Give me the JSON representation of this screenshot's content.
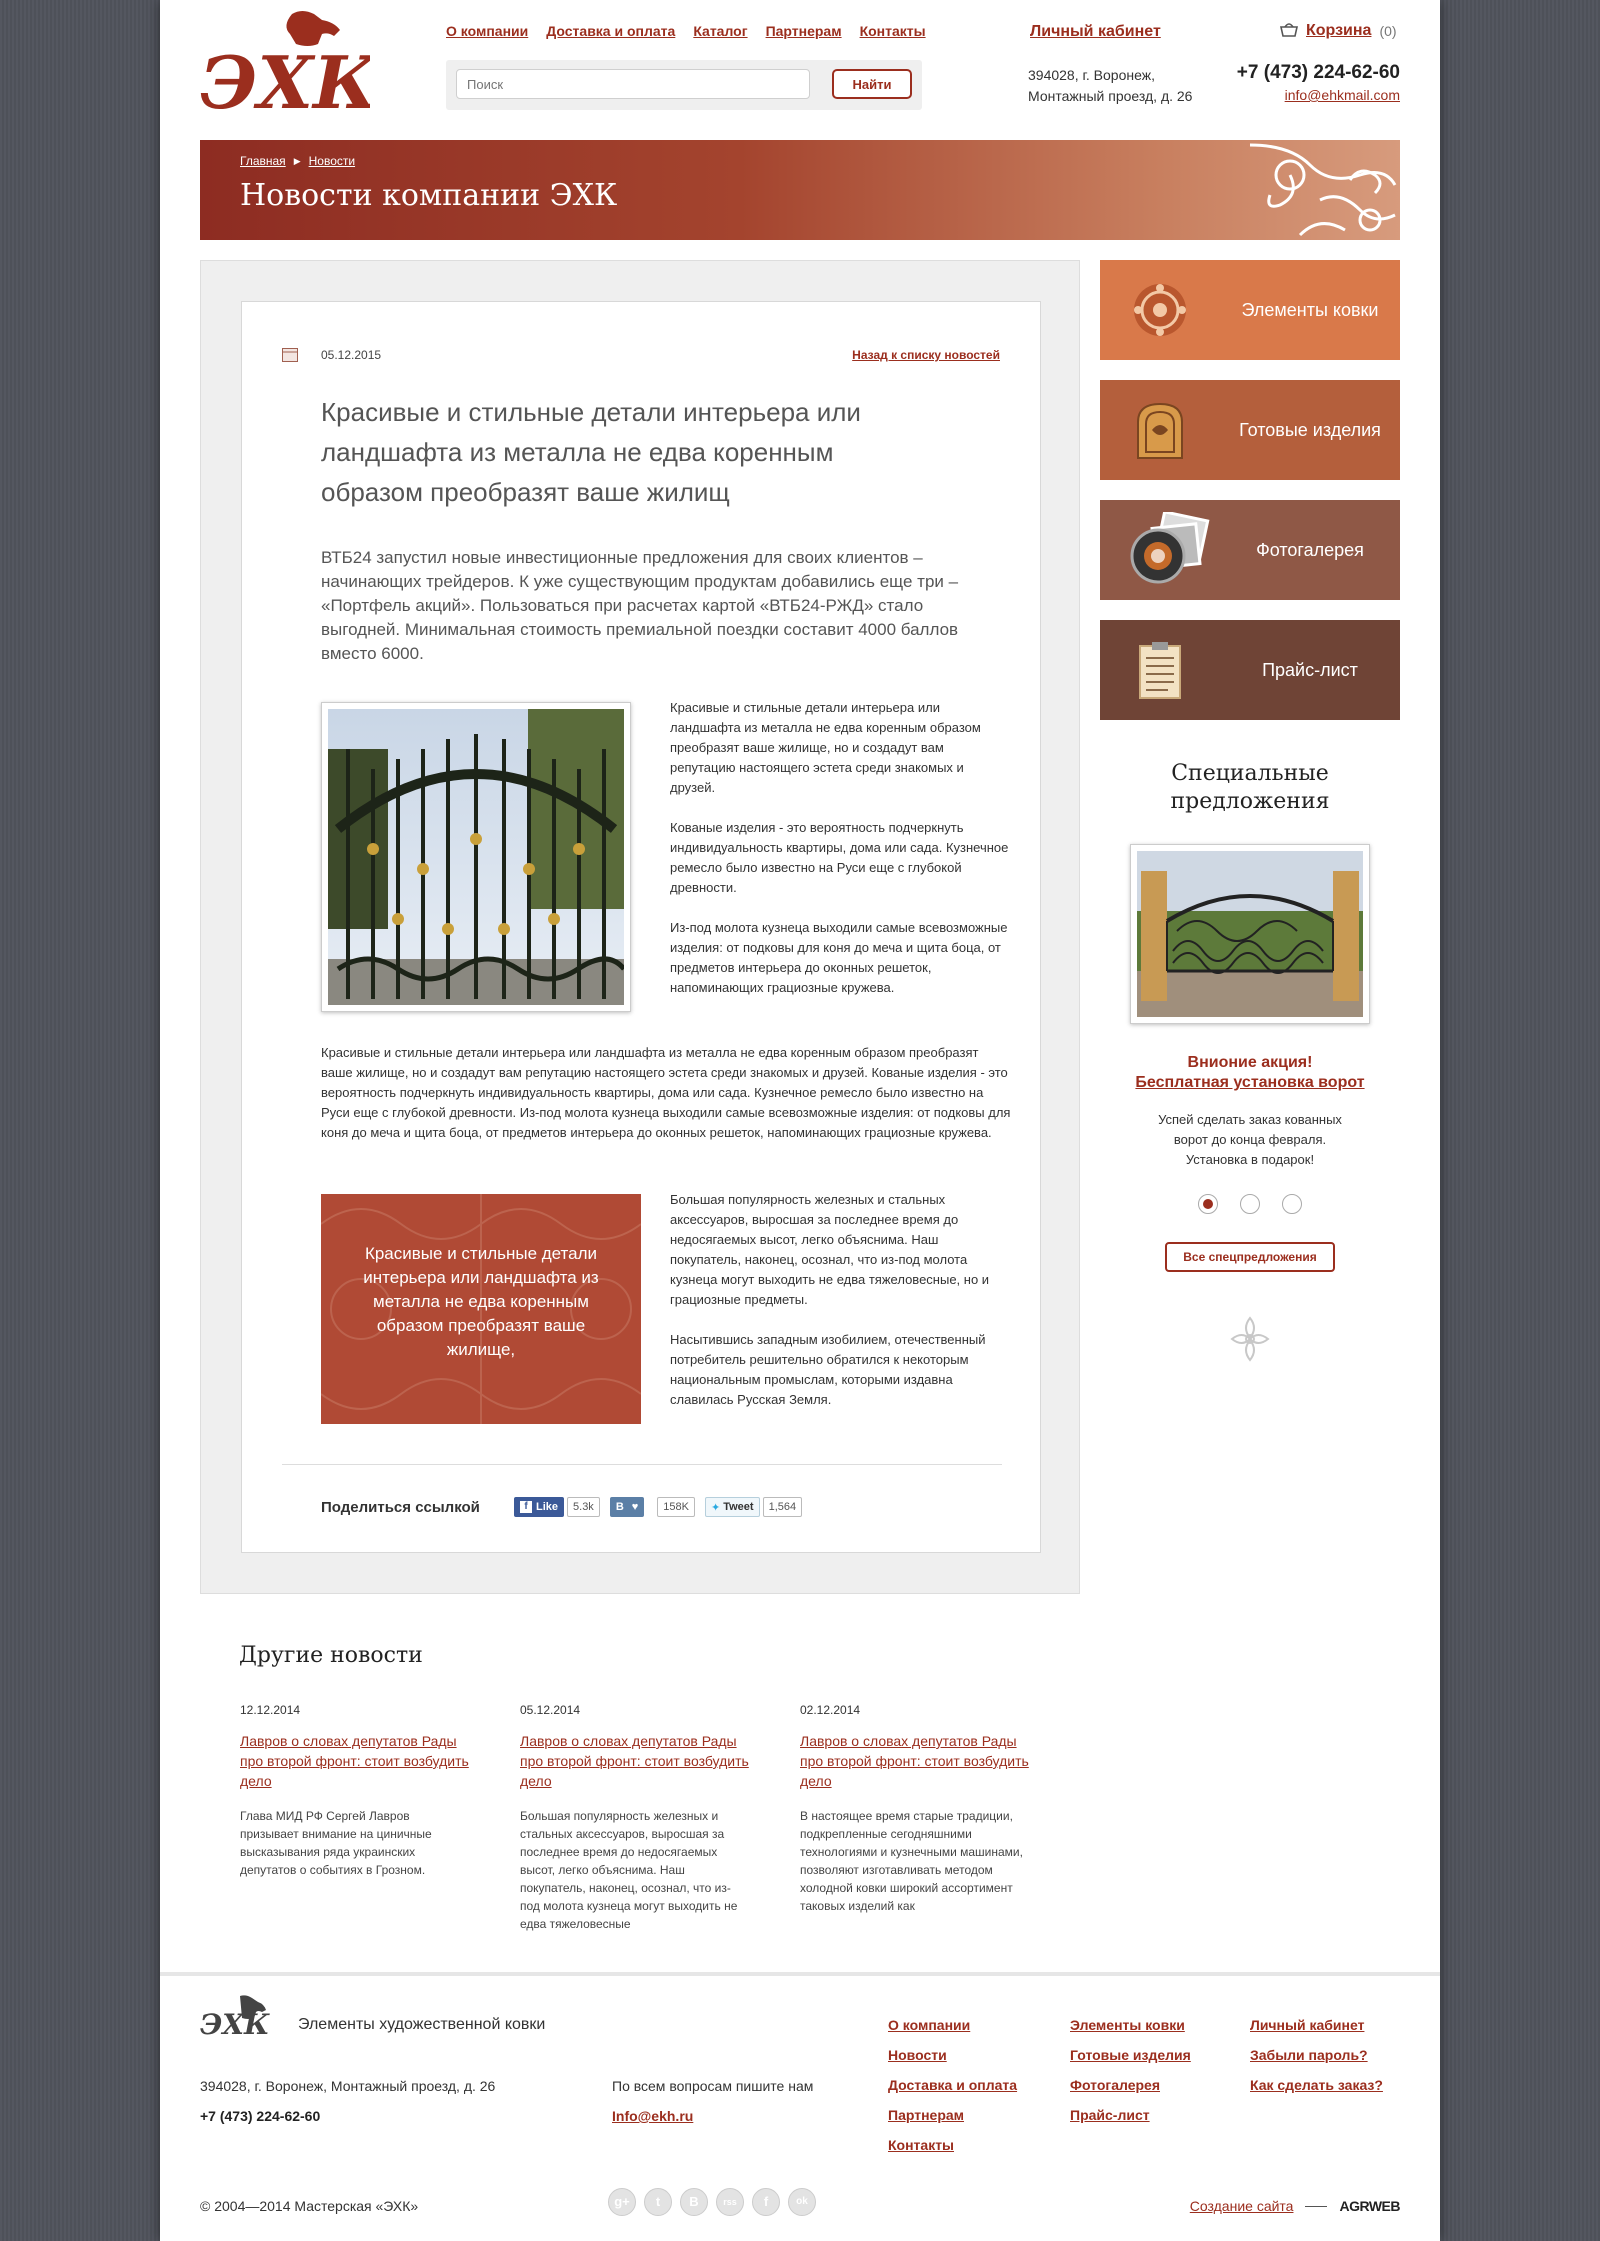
{
  "header": {
    "nav": [
      "О компании",
      "Доставка и оплата",
      "Каталог",
      "Партнерам",
      "Контакты"
    ],
    "search_placeholder": "Поиск",
    "search_button": "Найти",
    "cabinet": "Личный кабинет",
    "cart_label": "Корзина",
    "cart_count": "(0)",
    "address_line1": "394028, г. Воронеж,",
    "address_line2": "Монтажный проезд, д. 26",
    "phone": "+7 (473) 224-62-60",
    "email": "info@ehkmail.com"
  },
  "banner": {
    "breadcrumb_home": "Главная",
    "breadcrumb_current": "Новости",
    "title": "Новости компании ЭХК"
  },
  "article": {
    "date": "05.12.2015",
    "back_link": "Назад к списку новостей",
    "title": "Красивые и стильные детали интерьера или ландшафта из металла не едва коренным образом преобразят ваше жилищ",
    "lead": "ВТБ24 запустил новые инвестиционные предложения для своих клиентов – начинающих трейдеров. К уже существующим продуктам добавились еще три – «Портфель акций». Пользоваться при расчетах картой «ВТБ24-РЖД» стало выгодней. Минимальная стоимость премиальной поездки составит 4000 баллов вместо 6000.",
    "col_p1": "Красивые и стильные детали интерьера или ландшафта из металла не едва коренным образом преобразят ваше жилище, но и создадут вам репутацию настоящего эстета среди знакомых и друзей.",
    "col_p2": "Кованые изделия - это вероятность подчеркнуть индивидуальность квартиры, дома или сада. Кузнечное ремесло было известно на Руси еще с глубокой древности.",
    "col_p3": "Из-под молота кузнеца выходили самые всевозможные изделия: от подковы для коня до меча и щита боца, от предметов интерьера до оконных решеток, напоминающих грациозные кружева.",
    "full_p": "Красивые и стильные детали интерьера или ландшафта из металла не едва коренным образом преобразят ваше жилище, но и создадут вам репутацию настоящего эстета среди знакомых и друзей. Кованые изделия - это вероятность подчеркнуть индивидуальность квартиры, дома или сада. Кузнечное ремесло было известно на Руси еще с глубокой древности. Из-под молота кузнеца выходили самые всевозможные изделия: от подковы для коня до меча и щита боца, от предметов интерьера до оконных решеток, напоминающих грациозные кружева.",
    "quote": "Красивые и стильные детали интерьера или ландшафта из металла не едва коренным образом преобразят ваше жилище,",
    "col2_p1": "Большая популярность железных и стальных аксессуаров, выросшая за последнее время до недосягаемых высот, легко объяснима. Наш покупатель, наконец, осознал, что из-под молота кузнеца могут выходить не едва тяжеловесные, но и грациозные предметы.",
    "col2_p2": "Насытившись западным изобилием, отечественный потребитель решительно обратился к некоторым национальным промыслам, которыми издавна славилась Русская Земля.",
    "share_label": "Поделиться ссылкой",
    "fb_label": "Like",
    "fb_count": "5.3k",
    "vk_label": "В",
    "vk_count": "158K",
    "tw_label": "Tweet",
    "tw_count": "1,564"
  },
  "sidebar": {
    "tiles": [
      {
        "label": "Элементы ковки",
        "color": "#d9794a"
      },
      {
        "label": "Готовые изделия",
        "color": "#b45f3c"
      },
      {
        "label": "Фотогалерея",
        "color": "#8f5846"
      },
      {
        "label": "Прайс-лист",
        "color": "#6f4436"
      }
    ],
    "special_title": "Специальные предложения",
    "promo_title1": "Внионие акция!",
    "promo_title2": "Бесплатная установка ворот",
    "promo_text": "Успей сделать заказ кованных ворот до конца февраля. Установка в подарок!",
    "all_offers": "Все спецпредложения"
  },
  "other_news": {
    "title": "Другие новости",
    "items": [
      {
        "date": "12.12.2014",
        "headline": "Лавров о словах депутатов Рады про второй фронт: стоит возбудить дело",
        "text": "Глава МИД РФ Сергей Лавров призывает внимание на циничные высказывания ряда украинских депутатов о событиях в Грозном."
      },
      {
        "date": "05.12.2014",
        "headline": "Лавров о словах депутатов Рады про второй фронт: стоит возбудить дело",
        "text": "Большая популярность железных и стальных аксессуаров, выросшая за последнее время до недосягаемых высот, легко объяснима. Наш покупатель, наконец, осознал, что из-под молота кузнеца могут выходить не едва тяжеловесные"
      },
      {
        "date": "02.12.2014",
        "headline": "Лавров о словах депутатов Рады про второй фронт: стоит возбудить дело",
        "text": "В настоящее время старые традиции, подкрепленные сегодняшними технологиями и кузнечными машинами, позволяют изготавливать методом холодной ковки широкий ассортимент таковых изделий как"
      }
    ]
  },
  "footer": {
    "tagline": "Элементы художественной ковки",
    "address": "394028, г. Воронеж, Монтажный проезд, д. 26",
    "phone": "+7 (473) 224-62-60",
    "questions": "По всем вопросам пишите нам",
    "email": "Info@ekh.ru",
    "col1": [
      "О компании",
      "Новости",
      "Доставка и оплата",
      "Партнерам",
      "Контакты"
    ],
    "col2": [
      "Элементы ковки",
      "Готовые изделия",
      "Фотогалерея",
      "Прайс-лист"
    ],
    "col3": [
      "Личный кабинет",
      "Забыли пароль?",
      "Как сделать заказ?"
    ],
    "copyright": "© 2004—2014 Мастерская «ЭХК»",
    "social": [
      "g+",
      "t",
      "В",
      "rss",
      "f",
      "ok"
    ],
    "made_by": "Создание сайта",
    "agency": "AGRWEB"
  },
  "colors": {
    "brand": "#9b2e1e",
    "banner_start": "#8d2c22",
    "banner_end": "#d79b7d",
    "background": "#52555f"
  }
}
